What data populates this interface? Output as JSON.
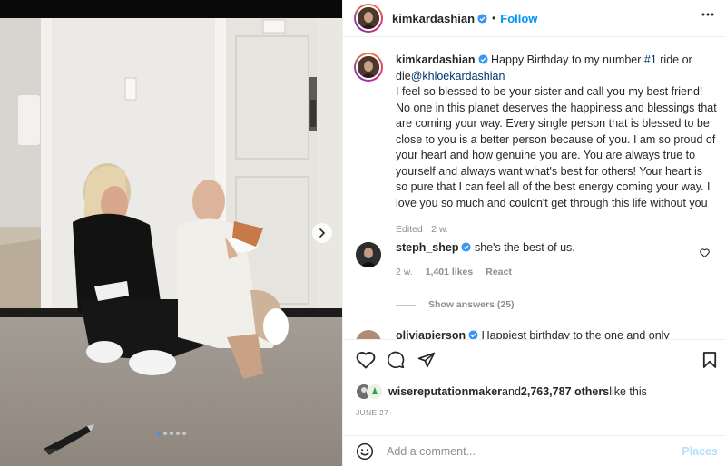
{
  "post": {
    "author": "kimkardashian",
    "follow_label": "Follow",
    "separator": "•"
  },
  "caption": {
    "username": "kimkardashian",
    "text_line1": "Happy Birthday to my number",
    "hashtag": "#1",
    "text_line1b": "ride or die",
    "mention": "@khloekardashian",
    "body": "I feel so blessed to be your sister and call you my best friend! No one in this planet deserves the happiness and blessings that are coming your way. Every single person that is blessed to be close to you is a better person because of you. I am so proud of your heart and how genuine you are. You are always true to yourself and always want what's best for others! Your heart is so pure that I can feel all of the best energy coming your way. I love you so much and couldn't get through this life without you",
    "edited": "Edited",
    "dot": "·",
    "time": "2 w."
  },
  "comments": [
    {
      "username": "steph_shep",
      "text": "she's the best of us.",
      "time": "2 w.",
      "likes": "1,401 likes",
      "reply_label": "React"
    },
    {
      "username": "oliviapierson",
      "text": "Happiest birthday to the one and only"
    }
  ],
  "show_answers": "Show answers (25)",
  "likes": {
    "liker": "wisereputationmaker",
    "and": "and",
    "count_text": "2,763,787 others",
    "suffix": "like this"
  },
  "date": "JUNE 27",
  "add_comment": {
    "placeholder": "Add a comment...",
    "post_label": "Places"
  },
  "carousel": {
    "total_slides": 5,
    "active_slide": 1
  },
  "icons": {
    "more": "more-horizontal-icon",
    "heart": "heart-icon",
    "comment": "comment-icon",
    "share": "share-icon",
    "save": "bookmark-icon",
    "emoji": "emoji-icon",
    "next": "chevron-right-icon",
    "verified": "verified-badge-icon"
  },
  "colors": {
    "accent": "#0095f6",
    "verified": "#3897f0",
    "muted": "#8e8e8e"
  }
}
